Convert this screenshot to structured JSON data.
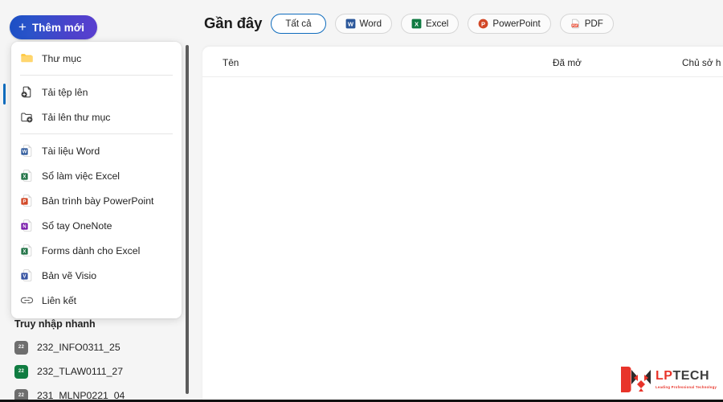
{
  "app": {
    "accent_blue": "#0f6cbd",
    "background": "#f5f5f5",
    "card_background": "#ffffff"
  },
  "left_nav": {
    "new_button": {
      "label": "Thêm mới",
      "icon": "plus-icon",
      "gradient_from": "#1b4fc4",
      "gradient_to": "#5b3fd0"
    },
    "new_menu": {
      "groups": [
        {
          "items": [
            {
              "label": "Thư mục",
              "icon": "folder-icon",
              "color": "#f7b718"
            }
          ]
        },
        {
          "items": [
            {
              "label": "Tải tệp lên",
              "icon": "file-upload-icon",
              "color": "#424242"
            },
            {
              "label": "Tải lên thư mục",
              "icon": "folder-upload-icon",
              "color": "#424242"
            }
          ]
        },
        {
          "items": [
            {
              "label": "Tài liệu Word",
              "icon": "word-document-icon",
              "color": "#2b579a"
            },
            {
              "label": "Sổ làm việc Excel",
              "icon": "excel-workbook-icon",
              "color": "#217346"
            },
            {
              "label": "Bản trình bày PowerPoint",
              "icon": "powerpoint-presentation-icon",
              "color": "#d24726"
            },
            {
              "label": "Sổ tay OneNote",
              "icon": "onenote-notebook-icon",
              "color": "#7719aa"
            },
            {
              "label": "Forms dành cho Excel",
              "icon": "forms-excel-icon",
              "color": "#217346"
            },
            {
              "label": "Bản vẽ Visio",
              "icon": "visio-drawing-icon",
              "color": "#3955a3"
            },
            {
              "label": "Liên kết",
              "icon": "link-icon",
              "color": "#616161"
            }
          ]
        }
      ]
    },
    "quick_access": {
      "title": "Truy nhập nhanh",
      "items": [
        {
          "label": "232_INFO0311_25",
          "icon": "site-tile-icon",
          "badge": "22",
          "color": "#6e6e6e"
        },
        {
          "label": "232_TLAW0111_27",
          "icon": "site-tile-icon",
          "badge": "22",
          "color": "#107c41"
        },
        {
          "label": "231_MLNP0221_04",
          "icon": "site-tile-icon",
          "badge": "22",
          "color": "#6e6e6e"
        }
      ]
    },
    "scrollbar": {
      "name": "left-nav-scrollbar"
    }
  },
  "main": {
    "title": "Gần đây",
    "filters": [
      {
        "label": "Tất cả",
        "icon": "none",
        "selected": true
      },
      {
        "label": "Word",
        "icon": "word-icon",
        "selected": false
      },
      {
        "label": "Excel",
        "icon": "excel-icon",
        "selected": false
      },
      {
        "label": "PowerPoint",
        "icon": "powerpoint-icon",
        "selected": false
      },
      {
        "label": "PDF",
        "icon": "pdf-icon",
        "selected": false
      }
    ],
    "table": {
      "columns": [
        {
          "label": "Tên"
        },
        {
          "label": "Đã mở"
        },
        {
          "label": "Chủ sở h"
        }
      ],
      "rows": []
    }
  },
  "watermark": {
    "name_lp": "LP",
    "name_tech": "TECH",
    "tagline": "Leading Professional Technology",
    "color": "#e8342a",
    "icon": "lptech-fox-logo"
  }
}
